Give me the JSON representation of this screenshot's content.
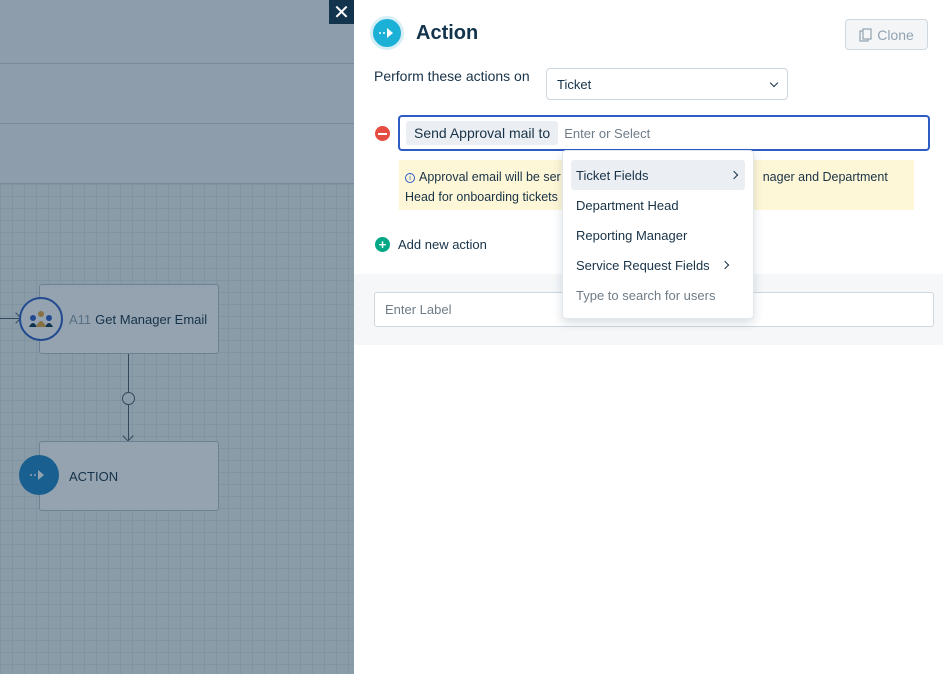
{
  "canvas": {
    "node1": {
      "id": "A11",
      "label": "Get Manager Email",
      "icon": "network-icon"
    },
    "node2": {
      "label": "ACTION",
      "icon": "action-arrow-icon"
    }
  },
  "close": {
    "icon": "close-icon",
    "glyph": "✕"
  },
  "panel": {
    "title": "Action",
    "icon": "action-arrow-icon",
    "clone_label": "Clone",
    "clone_icon": "copy-icon",
    "perform_label": "Perform these actions on",
    "perform_value": "Ticket",
    "action_chip": "Send Approval mail to",
    "action_placeholder": "Enter or Select",
    "info_text_1": "Approval email will be ser",
    "info_text_1_end": "nager and Department",
    "info_text_2": "Head for onboarding tickets",
    "info_icon_glyph": "i",
    "add_action_label": "Add new action",
    "add_action_glyph": "+",
    "label_placeholder": "Enter Label"
  },
  "dropdown": {
    "items": [
      {
        "label": "Ticket Fields",
        "submenu": true,
        "active": true
      },
      {
        "label": "Department Head",
        "submenu": false
      },
      {
        "label": "Reporting Manager",
        "submenu": false
      },
      {
        "label": "Service Request Fields",
        "submenu": true
      },
      {
        "label": "Type to search for users",
        "hint": true
      }
    ]
  },
  "colors": {
    "accent": "#2c5cc5",
    "header_icon": "#1bb0d6",
    "danger": "#e54d42",
    "success": "#00a886",
    "info_bg": "#fef7d7",
    "overlay": "#12344d"
  }
}
